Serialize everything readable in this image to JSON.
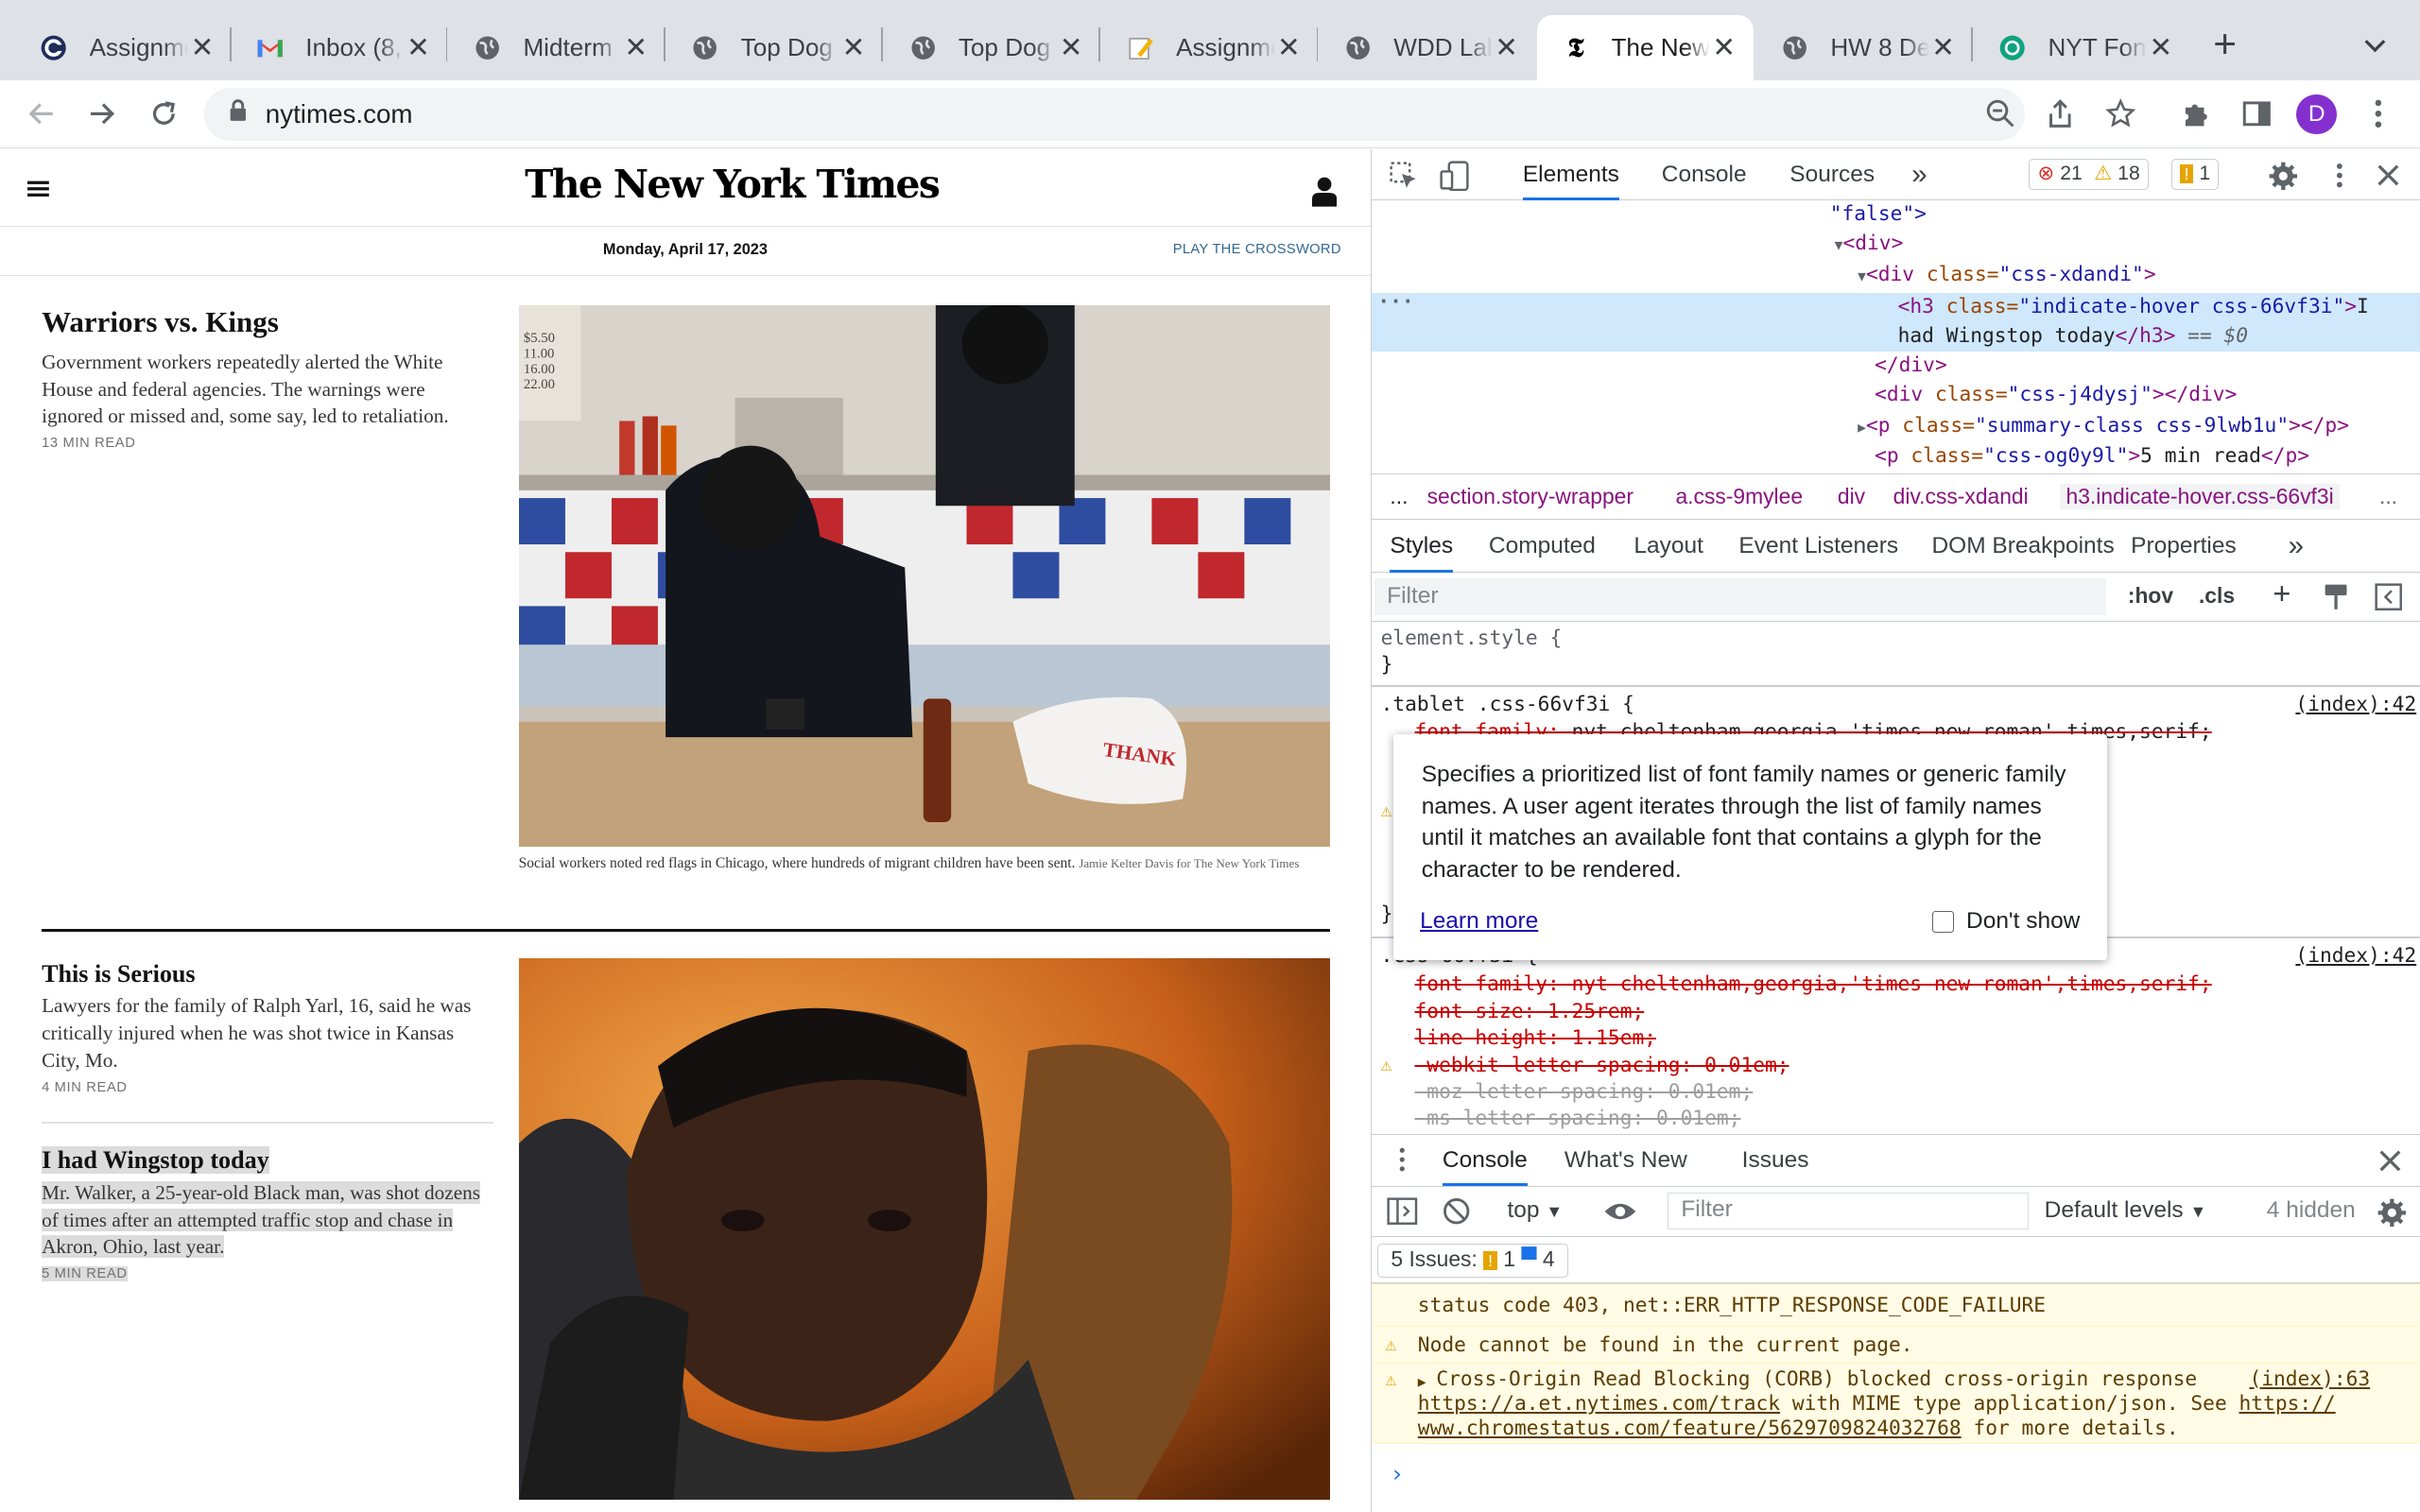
{
  "browser": {
    "tabs": [
      {
        "title": "Assignme",
        "icon": "c-logo-icon"
      },
      {
        "title": "Inbox (8,",
        "icon": "gmail-icon"
      },
      {
        "title": "Midterm",
        "icon": "globe-icon"
      },
      {
        "title": "Top Dog",
        "icon": "globe-icon"
      },
      {
        "title": "Top Dog",
        "icon": "globe-icon"
      },
      {
        "title": "Assignme",
        "icon": "pencil-icon"
      },
      {
        "title": "WDD Lab",
        "icon": "globe-icon"
      },
      {
        "title": "The New",
        "icon": "nyt-icon",
        "active": true
      },
      {
        "title": "HW 8 De",
        "icon": "globe-icon"
      },
      {
        "title": "NYT Fon",
        "icon": "openai-icon"
      }
    ],
    "url": "nytimes.com",
    "profile_initial": "D"
  },
  "nyt": {
    "masthead": "The New York Times",
    "date": "Monday, April 17, 2023",
    "crossword": "PLAY THE CROSSWORD",
    "stories": [
      {
        "headline": "Warriors vs. Kings",
        "summary": "Government workers repeatedly alerted the White House and federal agencies. The warnings were ignored or missed and, some say, led to retaliation.",
        "read": "13 MIN READ"
      },
      {
        "headline": "This is Serious",
        "summary": "Lawyers for the family of Ralph Yarl, 16, said he was critically injured when he was shot twice in Kansas City, Mo.",
        "read": "4 MIN READ"
      },
      {
        "headline": "I had Wingstop today",
        "summary": "Mr. Walker, a 25-year-old Black man, was shot dozens of times after an attempted traffic stop and chase in Akron, Ohio, last year.",
        "read": "5 MIN READ"
      }
    ],
    "photo1": {
      "caption": "Social workers noted red flags in Chicago, where hundreds of migrant children have been sent.",
      "credit": "Jamie Kelter Davis for The New York Times",
      "menu_prices": [
        "$5.50",
        "11.00",
        "16.00",
        "22.00"
      ],
      "bag_text": "THANK"
    }
  },
  "devtools": {
    "tabs": [
      "Elements",
      "Console",
      "Sources",
      "»"
    ],
    "errors": "21",
    "warnings": "18",
    "issues": "1",
    "dom": {
      "l1": "\"false\">",
      "l2": "<div>",
      "l3_tag": "<div ",
      "l3_attr": "class=",
      "l3_val": "\"css-xdandi\"",
      "l3_end": ">",
      "l4_tag": "<h3 ",
      "l4_attr": "class=",
      "l4_val": "\"indicate-hover css-66vf3i\"",
      "l4_text": "I",
      "l5_text": "had Wingstop today",
      "l5_end": "</h3>",
      "l5_eq": " == $0",
      "l6": "</div>",
      "l7_tag": "<div ",
      "l7_attr": "class=",
      "l7_val": "\"css-j4dysj\"",
      "l7_end": "></div>",
      "l8_tag": "<p ",
      "l8_attr": "class=",
      "l8_val": "\"summary-class css-9lwb1u\"",
      "l8_end": "></p>",
      "l9_tag": "<p ",
      "l9_attr": "class=",
      "l9_val": "\"css-og0y9l\"",
      "l9_text": "5 min read",
      "l9_end": "</p>"
    },
    "breadcrumbs": [
      "...",
      "section.story-wrapper",
      "a.css-9mylee",
      "div",
      "div.css-xdandi",
      "h3.indicate-hover.css-66vf3i",
      "..."
    ],
    "subtabs": [
      "Styles",
      "Computed",
      "Layout",
      "Event Listeners",
      "DOM Breakpoints",
      "Properties",
      "»"
    ],
    "filter_placeholder": "Filter",
    "hov": ":hov",
    "cls": ".cls",
    "styles": {
      "element_style": "element.style {",
      "close": "}",
      "rule1_selector": ".tablet .css-66vf3i {",
      "rule1_source": "(index):42",
      "rule1_prop": "font-family",
      "rule1_val": "nyt-cheltenham,georgia,'times new roman',times,serif;",
      "rule2_selector": ".css-66vf3i {",
      "rule2_source": "(index):42",
      "props": [
        "font-family: nyt-cheltenham,georgia,'times new roman',times,serif;",
        "font-size: 1.25rem;",
        "line-height: 1.15em;",
        "-webkit-letter-spacing: 0.01em;",
        "-moz-letter-spacing: 0.01em;",
        "-ms-letter-spacing: 0.01em;"
      ]
    },
    "tooltip": {
      "text": "Specifies a prioritized list of font family names or generic family names. A user agent iterates through the list of family names until it matches an available font that contains a glyph for the character to be rendered.",
      "learn_more": "Learn more",
      "dont_show": "Don't show"
    },
    "drawer_tabs": [
      "Console",
      "What's New",
      "Issues"
    ],
    "console": {
      "context": "top",
      "filter_placeholder": "Filter",
      "levels": "Default levels",
      "hidden": "4 hidden",
      "issues_label": "5 Issues:",
      "issues_warn": "1",
      "issues_info": "4",
      "msg1": "status code 403, net::ERR_HTTP_RESPONSE_CODE_FAILURE",
      "msg2": "Node cannot be found in the current page.",
      "msg3_a": "Cross-Origin Read Blocking (CORB) blocked cross-origin response",
      "msg3_src": "(index):63",
      "msg3_link1": "https://a.et.nytimes.com/track",
      "msg3_b": " with MIME type application/json. See ",
      "msg3_link2": "https://",
      "msg3_link3": "www.chromestatus.com/feature/5629709824032768",
      "msg3_c": " for more details."
    }
  }
}
